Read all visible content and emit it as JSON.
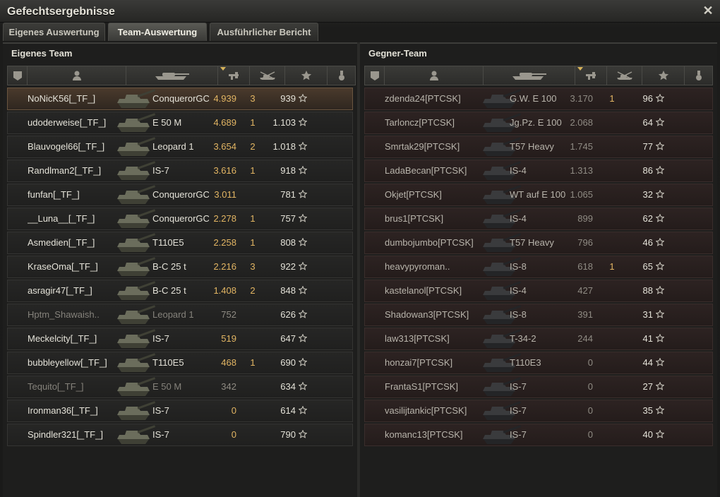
{
  "window": {
    "title": "Gefechtsergebnisse"
  },
  "tabs": [
    {
      "label": "Eigenes Auswertung",
      "active": false
    },
    {
      "label": "Team-Auswertung",
      "active": true
    },
    {
      "label": "Ausführlicher Bericht",
      "active": false
    }
  ],
  "own_team": {
    "title": "Eigenes Team",
    "players": [
      {
        "name": "NoNicK56[_TF_]",
        "vehicle": "ConquerorGC",
        "damage": "4.939",
        "kills": "3",
        "xp": "939",
        "highlight": true,
        "dead": false
      },
      {
        "name": "udoderweise[_TF_]",
        "vehicle": "E 50 M",
        "damage": "4.689",
        "kills": "1",
        "xp": "1.103",
        "highlight": false,
        "dead": false
      },
      {
        "name": "Blauvogel66[_TF_]",
        "vehicle": "Leopard 1",
        "damage": "3.654",
        "kills": "2",
        "xp": "1.018",
        "highlight": false,
        "dead": false
      },
      {
        "name": "Randlman2[_TF_]",
        "vehicle": "IS-7",
        "damage": "3.616",
        "kills": "1",
        "xp": "918",
        "highlight": false,
        "dead": false
      },
      {
        "name": "funfan[_TF_]",
        "vehicle": "ConquerorGC",
        "damage": "3.011",
        "kills": "",
        "xp": "781",
        "highlight": false,
        "dead": false
      },
      {
        "name": "__Luna__[_TF_]",
        "vehicle": "ConquerorGC",
        "damage": "2.278",
        "kills": "1",
        "xp": "757",
        "highlight": false,
        "dead": false
      },
      {
        "name": "Asmedien[_TF_]",
        "vehicle": "T110E5",
        "damage": "2.258",
        "kills": "1",
        "xp": "808",
        "highlight": false,
        "dead": false
      },
      {
        "name": "KraseOma[_TF_]",
        "vehicle": "B-C 25 t",
        "damage": "2.216",
        "kills": "3",
        "xp": "922",
        "highlight": false,
        "dead": false
      },
      {
        "name": "asragir47[_TF_]",
        "vehicle": "B-C 25 t",
        "damage": "1.408",
        "kills": "2",
        "xp": "848",
        "highlight": false,
        "dead": false
      },
      {
        "name": "Hptm_Shawaish..",
        "vehicle": "Leopard 1",
        "damage": "752",
        "kills": "",
        "xp": "626",
        "highlight": false,
        "dead": true
      },
      {
        "name": "Meckelcity[_TF_]",
        "vehicle": "IS-7",
        "damage": "519",
        "kills": "",
        "xp": "647",
        "highlight": false,
        "dead": false
      },
      {
        "name": "bubbleyellow[_TF_]",
        "vehicle": "T110E5",
        "damage": "468",
        "kills": "1",
        "xp": "690",
        "highlight": false,
        "dead": false
      },
      {
        "name": "Tequito[_TF_]",
        "vehicle": "E 50 M",
        "damage": "342",
        "kills": "",
        "xp": "634",
        "highlight": false,
        "dead": true
      },
      {
        "name": "Ironman36[_TF_]",
        "vehicle": "IS-7",
        "damage": "0",
        "kills": "",
        "xp": "614",
        "highlight": false,
        "dead": false
      },
      {
        "name": "Spindler321[_TF_]",
        "vehicle": "IS-7",
        "damage": "0",
        "kills": "",
        "xp": "790",
        "highlight": false,
        "dead": false
      }
    ]
  },
  "enemy_team": {
    "title": "Gegner-Team",
    "players": [
      {
        "name": "zdenda24[PTCSK]",
        "vehicle": "G.W. E 100",
        "damage": "3.170",
        "kills": "1",
        "xp": "96"
      },
      {
        "name": "Tarloncz[PTCSK]",
        "vehicle": "Jg.Pz. E 100",
        "damage": "2.068",
        "kills": "",
        "xp": "64"
      },
      {
        "name": "Smrtak29[PTCSK]",
        "vehicle": "T57 Heavy",
        "damage": "1.745",
        "kills": "",
        "xp": "77"
      },
      {
        "name": "LadaBecan[PTCSK]",
        "vehicle": "IS-4",
        "damage": "1.313",
        "kills": "",
        "xp": "86"
      },
      {
        "name": "Okjet[PTCSK]",
        "vehicle": "WT auf E 100",
        "damage": "1.065",
        "kills": "",
        "xp": "32"
      },
      {
        "name": "brus1[PTCSK]",
        "vehicle": "IS-4",
        "damage": "899",
        "kills": "",
        "xp": "62"
      },
      {
        "name": "dumbojumbo[PTCSK]",
        "vehicle": "T57 Heavy",
        "damage": "796",
        "kills": "",
        "xp": "46"
      },
      {
        "name": "heavypyroman..",
        "vehicle": "IS-8",
        "damage": "618",
        "kills": "1",
        "xp": "65"
      },
      {
        "name": "kastelanol[PTCSK]",
        "vehicle": "IS-4",
        "damage": "427",
        "kills": "",
        "xp": "88"
      },
      {
        "name": "Shadowan3[PTCSK]",
        "vehicle": "IS-8",
        "damage": "391",
        "kills": "",
        "xp": "31"
      },
      {
        "name": "law313[PTCSK]",
        "vehicle": "T-34-2",
        "damage": "244",
        "kills": "",
        "xp": "41"
      },
      {
        "name": "honzai7[PTCSK]",
        "vehicle": "T110E3",
        "damage": "0",
        "kills": "",
        "xp": "44"
      },
      {
        "name": "FrantaS1[PTCSK]",
        "vehicle": "IS-7",
        "damage": "0",
        "kills": "",
        "xp": "27"
      },
      {
        "name": "vasilijtankic[PTCSK]",
        "vehicle": "IS-7",
        "damage": "0",
        "kills": "",
        "xp": "35"
      },
      {
        "name": "komanc13[PTCSK]",
        "vehicle": "IS-7",
        "damage": "0",
        "kills": "",
        "xp": "40"
      }
    ]
  },
  "columns": [
    {
      "icon": "platoon-icon"
    },
    {
      "icon": "player-icon"
    },
    {
      "icon": "tank-icon"
    },
    {
      "icon": "damage-icon",
      "sorted": true
    },
    {
      "icon": "kills-icon"
    },
    {
      "icon": "xp-star-icon"
    },
    {
      "icon": "medal-icon"
    }
  ],
  "colors": {
    "accent": "#e2b563",
    "highlight_row": "#4a3a2c",
    "enemy_row": "#2d2322"
  }
}
